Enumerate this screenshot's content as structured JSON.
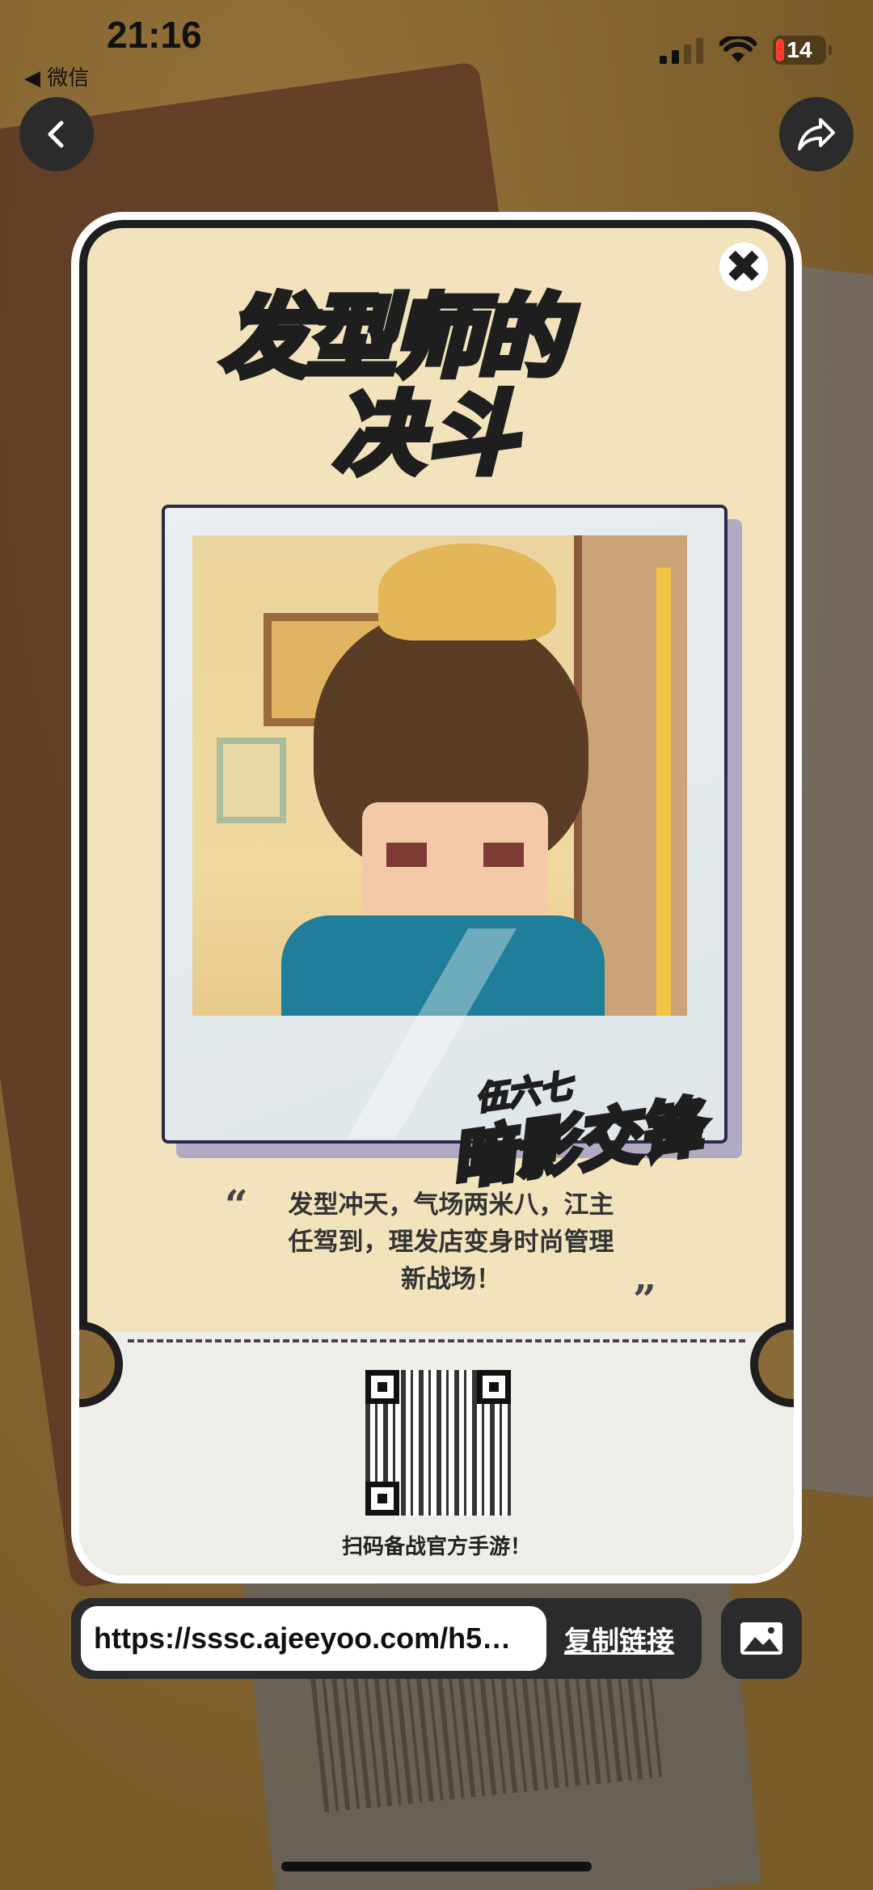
{
  "status_bar": {
    "time": "21:16",
    "back_app": "◀ 微信",
    "battery": "14"
  },
  "nav": {
    "back_icon": "chevron-left-icon",
    "share_icon": "share-arrow-icon"
  },
  "card": {
    "logo_line1": "发型师的",
    "logo_line2": "决斗",
    "badge_small": "伍六七",
    "badge_big": "暗影交锋",
    "quote_lines": [
      "发型冲天，气场两米八，江主",
      "任驾到，理发店变身时尚管理",
      "新战场！"
    ],
    "quote_open": "“",
    "quote_close": "”",
    "qr_caption": "扫码备战官方手游！"
  },
  "link_bar": {
    "url": "https://sssc.ajeeyoo.com/h5…",
    "copy_label": "复制链接"
  },
  "colors": {
    "card_bg": "#f2e3bd",
    "logo_blue": "#3ca0f0",
    "logo_yellow": "#d9ec3a"
  }
}
